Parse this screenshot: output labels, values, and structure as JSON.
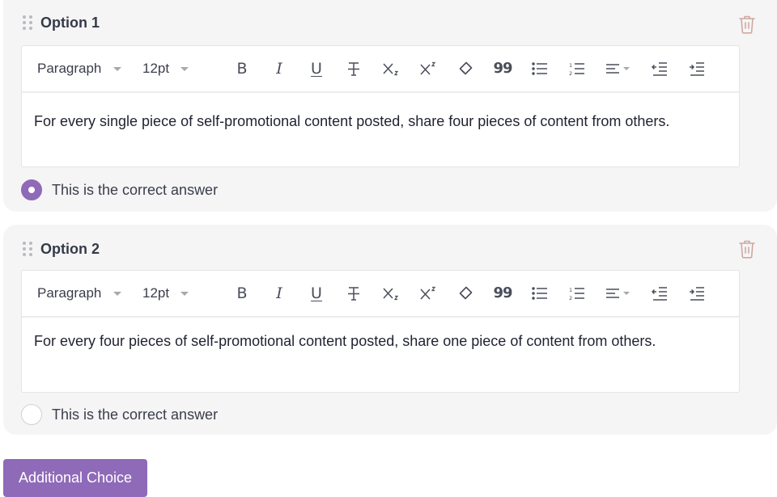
{
  "colors": {
    "accent": "#8f6ab8",
    "card_background": "#f5f5f6",
    "trash": "#d0a8a0"
  },
  "toolbar": {
    "block_format": "Paragraph",
    "font_size": "12pt",
    "buttons": [
      {
        "name": "bold",
        "icon": "bold-icon",
        "glyph": "B"
      },
      {
        "name": "italic",
        "icon": "italic-icon",
        "glyph": "I"
      },
      {
        "name": "underline",
        "icon": "underline-icon",
        "glyph": "U"
      },
      {
        "name": "strikethrough",
        "icon": "strikethrough-icon"
      },
      {
        "name": "subscript",
        "icon": "subscript-icon"
      },
      {
        "name": "superscript",
        "icon": "superscript-icon"
      },
      {
        "name": "clear-formatting",
        "icon": "eraser-icon"
      },
      {
        "name": "blockquote",
        "icon": "quote-icon",
        "glyph": "99"
      },
      {
        "name": "bullet-list",
        "icon": "bullet-list-icon"
      },
      {
        "name": "numbered-list",
        "icon": "numbered-list-icon"
      },
      {
        "name": "align",
        "icon": "align-left-icon"
      },
      {
        "name": "outdent",
        "icon": "outdent-icon"
      },
      {
        "name": "indent",
        "icon": "indent-icon"
      }
    ]
  },
  "options": [
    {
      "title": "Option 1",
      "content": "For every single piece of self-promotional content posted, share four pieces of content from others.",
      "correct_label": "This is the correct answer",
      "is_correct": true
    },
    {
      "title": "Option 2",
      "content": "For every four pieces of self-promotional content posted, share one piece of content from others.",
      "correct_label": "This is the correct answer",
      "is_correct": false
    }
  ],
  "add_button_label": "Additional Choice"
}
